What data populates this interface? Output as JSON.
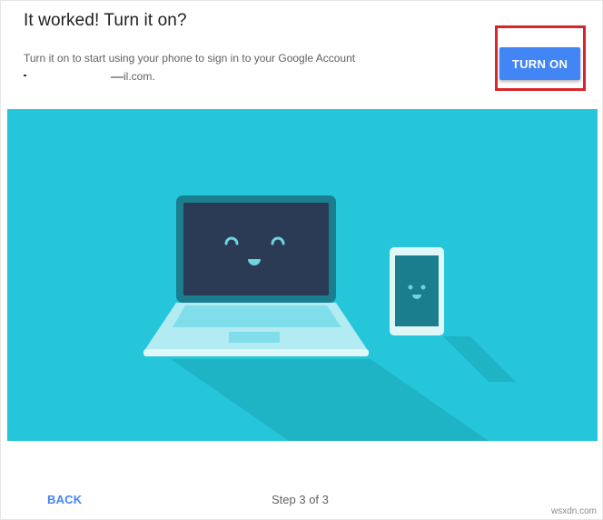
{
  "dialog": {
    "title": "It worked! Turn it on?",
    "subtitle": "Turn it on to start using your phone to sign in to your Google Account",
    "account_suffix": "il.com.",
    "turn_on_label": "TURN ON"
  },
  "footer": {
    "back_label": "BACK",
    "step_text": "Step 3 of 3"
  },
  "watermark": "wsxdn.com",
  "colors": {
    "accent": "#4285f4",
    "illustration_bg": "#26c6da",
    "highlight_border": "#d9252a",
    "laptop_screen": "#2b3a55"
  },
  "icons": [
    "laptop-illustration",
    "phone-illustration"
  ]
}
